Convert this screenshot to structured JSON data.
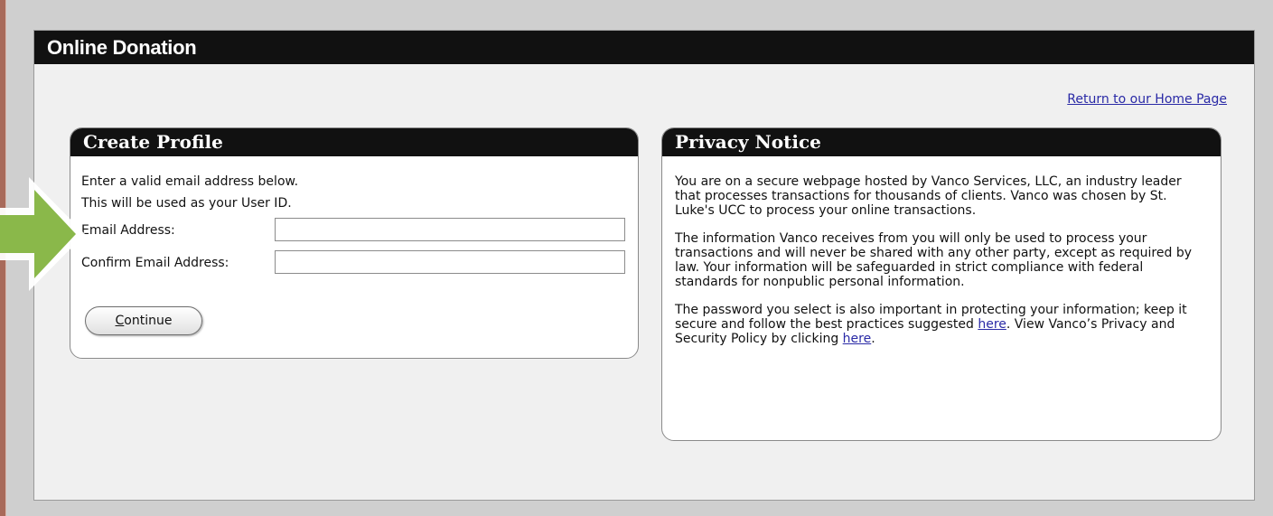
{
  "page": {
    "title": "Online Donation",
    "home_link": "Return to our Home Page"
  },
  "create_profile": {
    "title": "Create Profile",
    "intro_line_1": "Enter a valid email address below.",
    "intro_line_2": "This will be used as your User ID.",
    "email_label": "Email Address:",
    "email_value": "",
    "confirm_label": "Confirm Email Address:",
    "confirm_value": "",
    "continue_first": "C",
    "continue_rest": "ontinue"
  },
  "privacy": {
    "title": "Privacy Notice",
    "p1": "You are on a secure webpage hosted by Vanco Services, LLC, an industry leader that processes transactions for thousands of clients. Vanco was chosen by St. Luke's UCC to process your online transactions.",
    "p2": "The information Vanco receives from you will only be used to process your transactions and will never be shared with any other party, except as required by law. Your information will be safeguarded in strict compliance with federal standards for nonpublic personal information.",
    "p3_a": "The password you select is also important in protecting your information; keep it secure and follow the best practices suggested ",
    "p3_link1": "here",
    "p3_b": ". View Vanco’s Privacy and Security Policy by clicking ",
    "p3_link2": "here",
    "p3_c": "."
  },
  "colors": {
    "header_bg": "#111111",
    "link": "#2a2aa6",
    "arrow": "#8ab84a",
    "page_bg": "#f0f0f0"
  },
  "icons": {
    "pointer": "green-arrow-icon"
  }
}
